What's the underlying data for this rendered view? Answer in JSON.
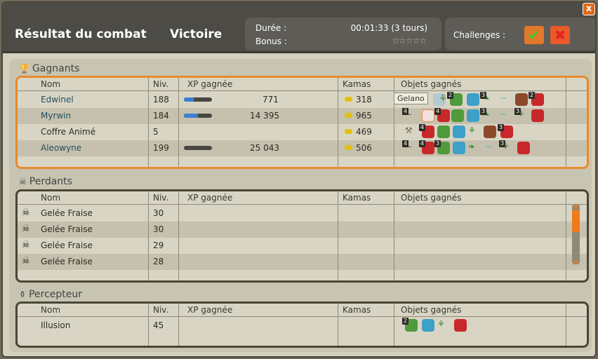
{
  "title": "Résultat du combat",
  "result": "Victoire",
  "duration_label": "Durée :",
  "duration_value": "00:01:33 (3 tours)",
  "bonus_label": "Bonus :",
  "bonus_stars": "☆☆☆☆☆",
  "challenges_label": "Challenges :",
  "close": "x",
  "columns": {
    "name": "Nom",
    "level": "Niv.",
    "xp": "XP gagnée",
    "kamas": "Kamas",
    "items": "Objets gagnés"
  },
  "winners": {
    "title": "Gagnants",
    "rows": [
      {
        "name": "Edwinel",
        "level": "188",
        "xp": "771",
        "xp_fill": 0.35,
        "kamas": "318"
      },
      {
        "name": "Myrwin",
        "level": "184",
        "xp": "14 395",
        "xp_fill": 0.5,
        "kamas": "965"
      },
      {
        "name": "Coffre Animé",
        "level": "5",
        "xp": "",
        "xp_fill": null,
        "kamas": "469"
      },
      {
        "name": "Aleowyne",
        "level": "199",
        "xp": "25 043",
        "xp_fill": 0,
        "kamas": "506"
      }
    ],
    "tooltip": "Gelano"
  },
  "losers": {
    "title": "Perdants",
    "rows": [
      {
        "name": "Gelée Fraise",
        "level": "30"
      },
      {
        "name": "Gelée Fraise",
        "level": "30"
      },
      {
        "name": "Gelée Fraise",
        "level": "29"
      },
      {
        "name": "Gelée Fraise",
        "level": "28"
      }
    ]
  },
  "collector": {
    "title": "Percepteur",
    "rows": [
      {
        "name": "Illusion",
        "level": "45"
      }
    ]
  },
  "item_qty": {
    "edwinel": [
      "2",
      "3",
      "2"
    ],
    "myrwin": [
      "4",
      "4",
      "3",
      "3"
    ],
    "coffre": [
      "4",
      "3"
    ],
    "aleowyne": [
      "4",
      "4",
      "3",
      "3"
    ],
    "illusion": [
      "2"
    ]
  }
}
